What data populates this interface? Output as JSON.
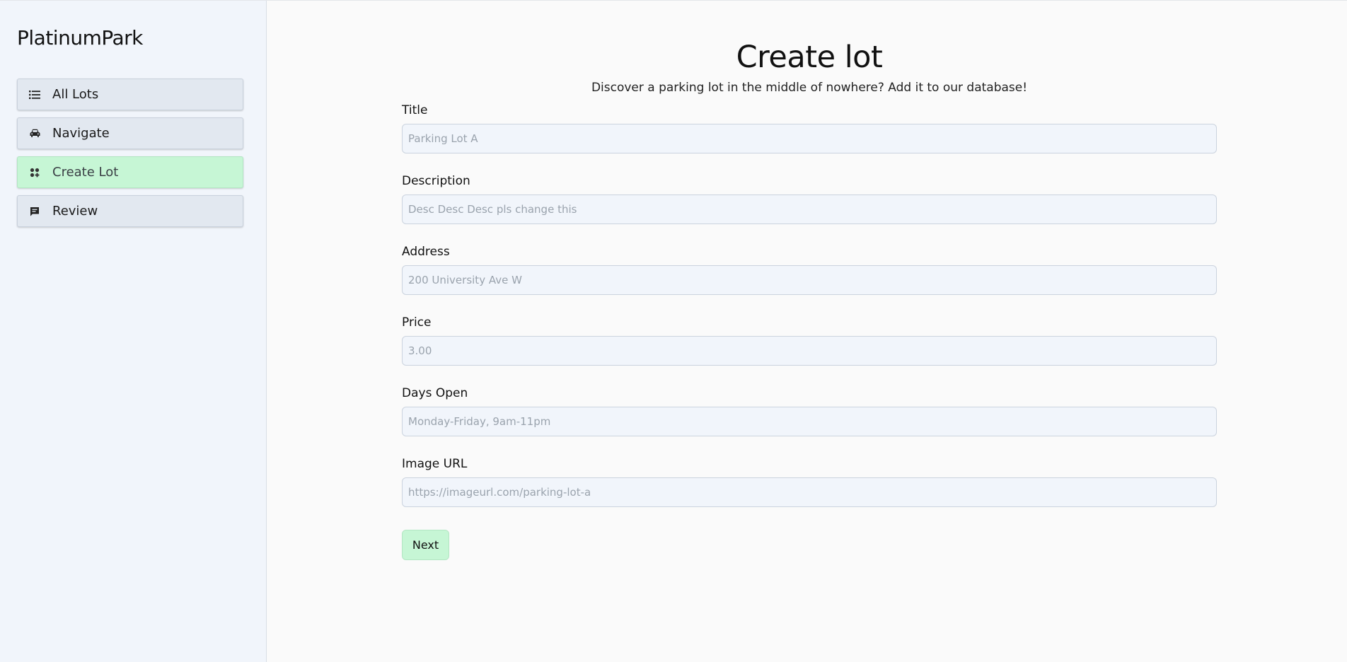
{
  "brand": "PlatinumPark",
  "sidebar": {
    "items": [
      {
        "label": "All Lots",
        "icon": "list-icon",
        "active": false
      },
      {
        "label": "Navigate",
        "icon": "car-icon",
        "active": false
      },
      {
        "label": "Create Lot",
        "icon": "grid-icon",
        "active": true
      },
      {
        "label": "Review",
        "icon": "message-icon",
        "active": false
      }
    ]
  },
  "main": {
    "title": "Create lot",
    "subtitle": "Discover a parking lot in the middle of nowhere? Add it to our database!",
    "fields": [
      {
        "label": "Title",
        "placeholder": "Parking Lot A",
        "value": ""
      },
      {
        "label": "Description",
        "placeholder": "Desc Desc Desc pls change this",
        "value": ""
      },
      {
        "label": "Address",
        "placeholder": "200 University Ave W",
        "value": ""
      },
      {
        "label": "Price",
        "placeholder": "3.00",
        "value": ""
      },
      {
        "label": "Days Open",
        "placeholder": "Monday-Friday, 9am-11pm",
        "value": ""
      },
      {
        "label": "Image URL",
        "placeholder": "https://imageurl.com/parking-lot-a",
        "value": ""
      }
    ],
    "next_label": "Next"
  },
  "colors": {
    "accent_green": "#c6f6d5",
    "sidebar_bg": "#f1f5fb",
    "nav_item_bg": "#e2e8f0"
  }
}
